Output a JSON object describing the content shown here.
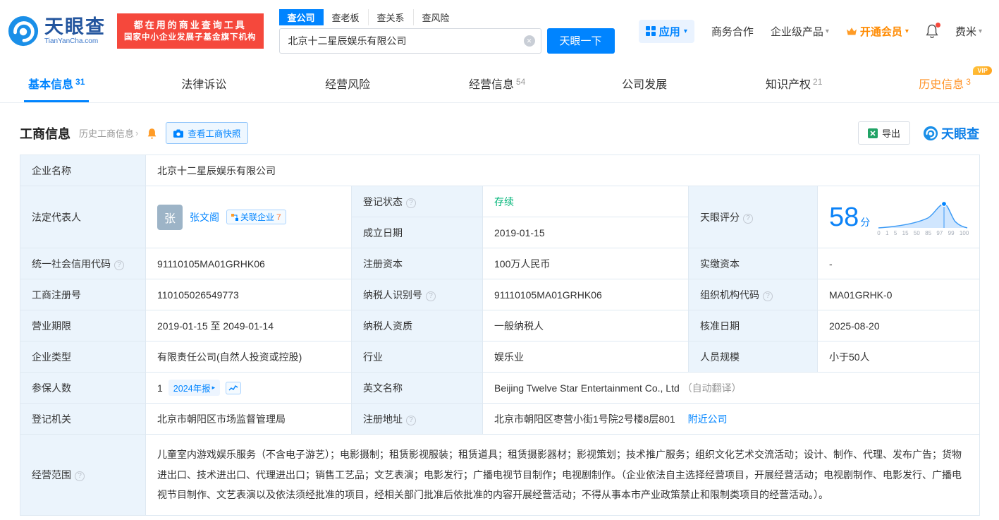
{
  "colors": {
    "primary": "#0084ff",
    "banner_red": "#f5483c",
    "status_green": "#00b578",
    "vip_orange": "#ff9429"
  },
  "icons": {
    "help": "?",
    "chevron": "›",
    "clear": "✕",
    "caret": "▾",
    "caret_right": "▸"
  },
  "header": {
    "logo_title": "天眼查",
    "logo_domain": "TianYanCha.com",
    "banner_line1": "都在用的商业查询工具",
    "banner_line2": "国家中小企业发展子基金旗下机构",
    "search_tabs": [
      {
        "label": "查公司"
      },
      {
        "label": "查老板"
      },
      {
        "label": "查关系"
      },
      {
        "label": "查风险"
      }
    ],
    "search_value": "北京十二星辰娱乐有限公司",
    "search_button": "天眼一下",
    "right": {
      "app": "应用",
      "cooperation": "商务合作",
      "enterprise": "企业级产品",
      "vip": "开通会员",
      "user": "费米"
    }
  },
  "tabs": [
    {
      "label": "基本信息",
      "count": "31"
    },
    {
      "label": "法律诉讼",
      "count": ""
    },
    {
      "label": "经营风险",
      "count": ""
    },
    {
      "label": "经营信息",
      "count": "54"
    },
    {
      "label": "公司发展",
      "count": ""
    },
    {
      "label": "知识产权",
      "count": "21"
    },
    {
      "label": "历史信息",
      "count": "3",
      "vip_badge": "VIP"
    }
  ],
  "section": {
    "title": "工商信息",
    "history_link": "历史工商信息",
    "snapshot_button": "查看工商快照",
    "export_button": "导出",
    "brand": "天眼查"
  },
  "info": {
    "company_name_label": "企业名称",
    "company_name": "北京十二星辰娱乐有限公司",
    "legal_rep_label": "法定代表人",
    "legal_rep_avatar": "张",
    "legal_rep_name": "张文阁",
    "related_badge": "关联企业",
    "related_count": "7",
    "reg_status_label": "登记状态",
    "reg_status": "存续",
    "establish_label": "成立日期",
    "establish_date": "2019-01-15",
    "score_label": "天眼评分",
    "score": "58",
    "score_unit": "分",
    "score_axis": [
      "0",
      "1",
      "5",
      "15",
      "50",
      "85",
      "97",
      "99",
      "100"
    ],
    "credit_code_label": "统一社会信用代码",
    "credit_code": "91110105MA01GRHK06",
    "reg_capital_label": "注册资本",
    "reg_capital": "100万人民币",
    "paid_capital_label": "实缴资本",
    "paid_capital": "-",
    "reg_number_label": "工商注册号",
    "reg_number": "110105026549773",
    "taxpayer_id_label": "纳税人识别号",
    "taxpayer_id": "91110105MA01GRHK06",
    "org_code_label": "组织机构代码",
    "org_code": "MA01GRHK-0",
    "business_term_label": "营业期限",
    "business_term": "2019-01-15 至 2049-01-14",
    "taxpayer_quality_label": "纳税人资质",
    "taxpayer_quality": "一般纳税人",
    "approval_date_label": "核准日期",
    "approval_date": "2025-08-20",
    "company_type_label": "企业类型",
    "company_type": "有限责任公司(自然人投资或控股)",
    "industry_label": "行业",
    "industry": "娱乐业",
    "staff_size_label": "人员规模",
    "staff_size": "小于50人",
    "insured_label": "参保人数",
    "insured_count": "1",
    "annual_report": "2024年报",
    "english_name_label": "英文名称",
    "english_name": "Beijing Twelve Star Entertainment Co., Ltd",
    "english_name_note": "（自动翻译）",
    "reg_authority_label": "登记机关",
    "reg_authority": "北京市朝阳区市场监督管理局",
    "reg_address_label": "注册地址",
    "reg_address": "北京市朝阳区枣营小街1号院2号楼8层801",
    "nearby_link": "附近公司",
    "business_scope_label": "经营范围",
    "business_scope": "儿童室内游戏娱乐服务（不含电子游艺）；电影摄制；租赁影视服装；租赁道具；租赁摄影器材；影视策划；技术推广服务；组织文化艺术交流活动；设计、制作、代理、发布广告；货物进出口、技术进出口、代理进出口；销售工艺品；文艺表演；电影发行；广播电视节目制作；电视剧制作。（企业依法自主选择经营项目，开展经营活动；电视剧制作、电影发行、广播电视节目制作、文艺表演以及依法须经批准的项目，经相关部门批准后依批准的内容开展经营活动；不得从事本市产业政策禁止和限制类项目的经营活动。）。"
  }
}
